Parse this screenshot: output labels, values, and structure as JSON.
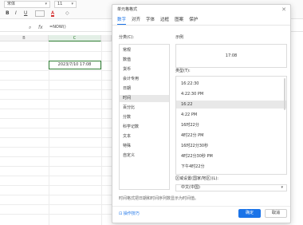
{
  "toolbar": {
    "font_name": "宋体",
    "font_size": "11",
    "bold": "B",
    "italic": "I",
    "underline": "U",
    "font_color": "A"
  },
  "formula_bar": {
    "name_box_icon": "⌕",
    "fx": "fx",
    "formula": "=NOW()"
  },
  "sheet": {
    "columns": [
      "B",
      "C"
    ],
    "active_cell_value": "2023/7/10 17:08"
  },
  "dialog": {
    "title": "单元格格式",
    "close": "✕",
    "tabs": [
      "数字",
      "对齐",
      "字体",
      "边框",
      "图案",
      "保护"
    ],
    "category_label": "分类(C):",
    "categories": [
      "常规",
      "数值",
      "货币",
      "会计专用",
      "日期",
      "时间",
      "百分比",
      "分数",
      "科学记数",
      "文本",
      "特殊",
      "自定义"
    ],
    "selected_category": "时间",
    "sample_label": "示例",
    "sample_value": "17:08",
    "type_label": "类型(T):",
    "types": [
      "16:22:30",
      "4:22:30 PM",
      "16:22",
      "4:22 PM",
      "16时22分",
      "4时22分 PM",
      "16时22分30秒",
      "4时22分30秒 PM",
      "下午4时22分"
    ],
    "selected_type": "16:22",
    "locale_label": "区域设置(国家/地区)(L):",
    "locale_value": "中文(中国)",
    "description": "时间格式把日期和时间序列数显示为时间值。",
    "tips": "操作技巧",
    "ok": "确定",
    "cancel": "取消"
  },
  "colors": {
    "accent": "#1a73e8",
    "sheet_accent": "#2e7d32"
  }
}
